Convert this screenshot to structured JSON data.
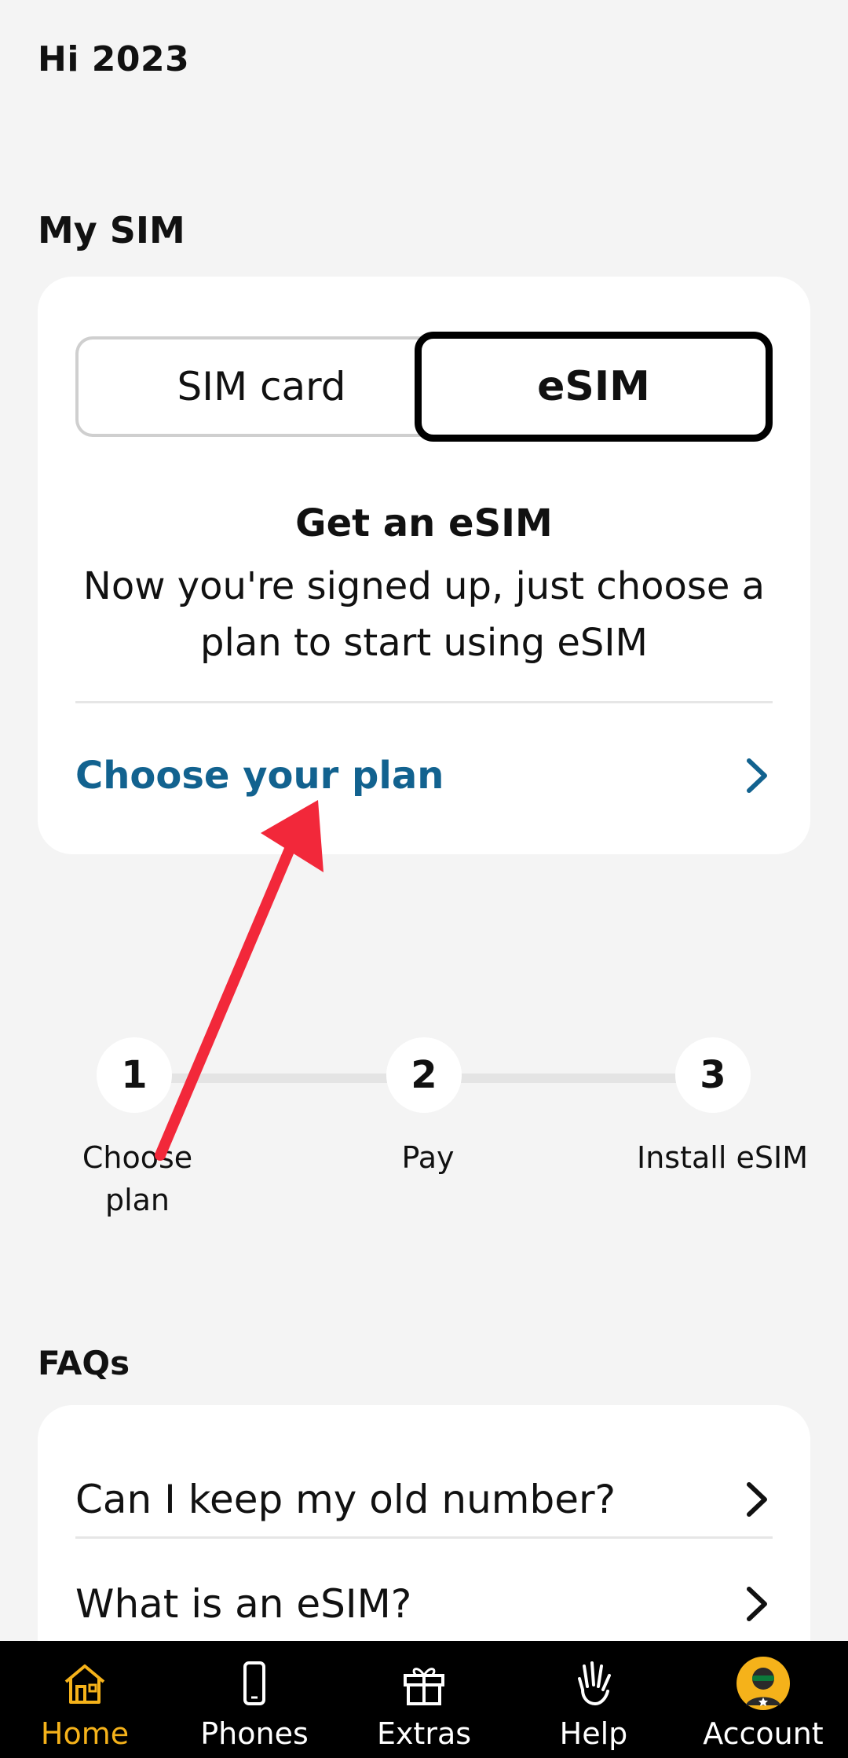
{
  "greeting": "Hi 2023",
  "my_sim": {
    "title": "My SIM",
    "toggle": {
      "sim_card": "SIM card",
      "esim": "eSIM",
      "selected": "eSIM"
    },
    "card_title": "Get an eSIM",
    "card_desc": "Now you're signed up, just choose a plan to start using eSIM",
    "link_label": "Choose your plan"
  },
  "steps": [
    {
      "number": "1",
      "label": "Choose plan"
    },
    {
      "number": "2",
      "label": "Pay"
    },
    {
      "number": "3",
      "label": "Install eSIM"
    }
  ],
  "faqs": {
    "title": "FAQs",
    "items": [
      {
        "question": "Can I keep my old number?"
      },
      {
        "question": "What is an eSIM?"
      }
    ]
  },
  "nav": {
    "items": [
      {
        "label": "Home",
        "icon": "home-icon",
        "active": true
      },
      {
        "label": "Phones",
        "icon": "phone-icon",
        "active": false
      },
      {
        "label": "Extras",
        "icon": "gift-icon",
        "active": false
      },
      {
        "label": "Help",
        "icon": "hand-icon",
        "active": false
      },
      {
        "label": "Account",
        "icon": "avatar-icon",
        "active": false
      }
    ]
  },
  "colors": {
    "background": "#f4f4f4",
    "link": "#12628f",
    "nav_active": "#f5b21a",
    "annotation_arrow": "#f2283a"
  }
}
